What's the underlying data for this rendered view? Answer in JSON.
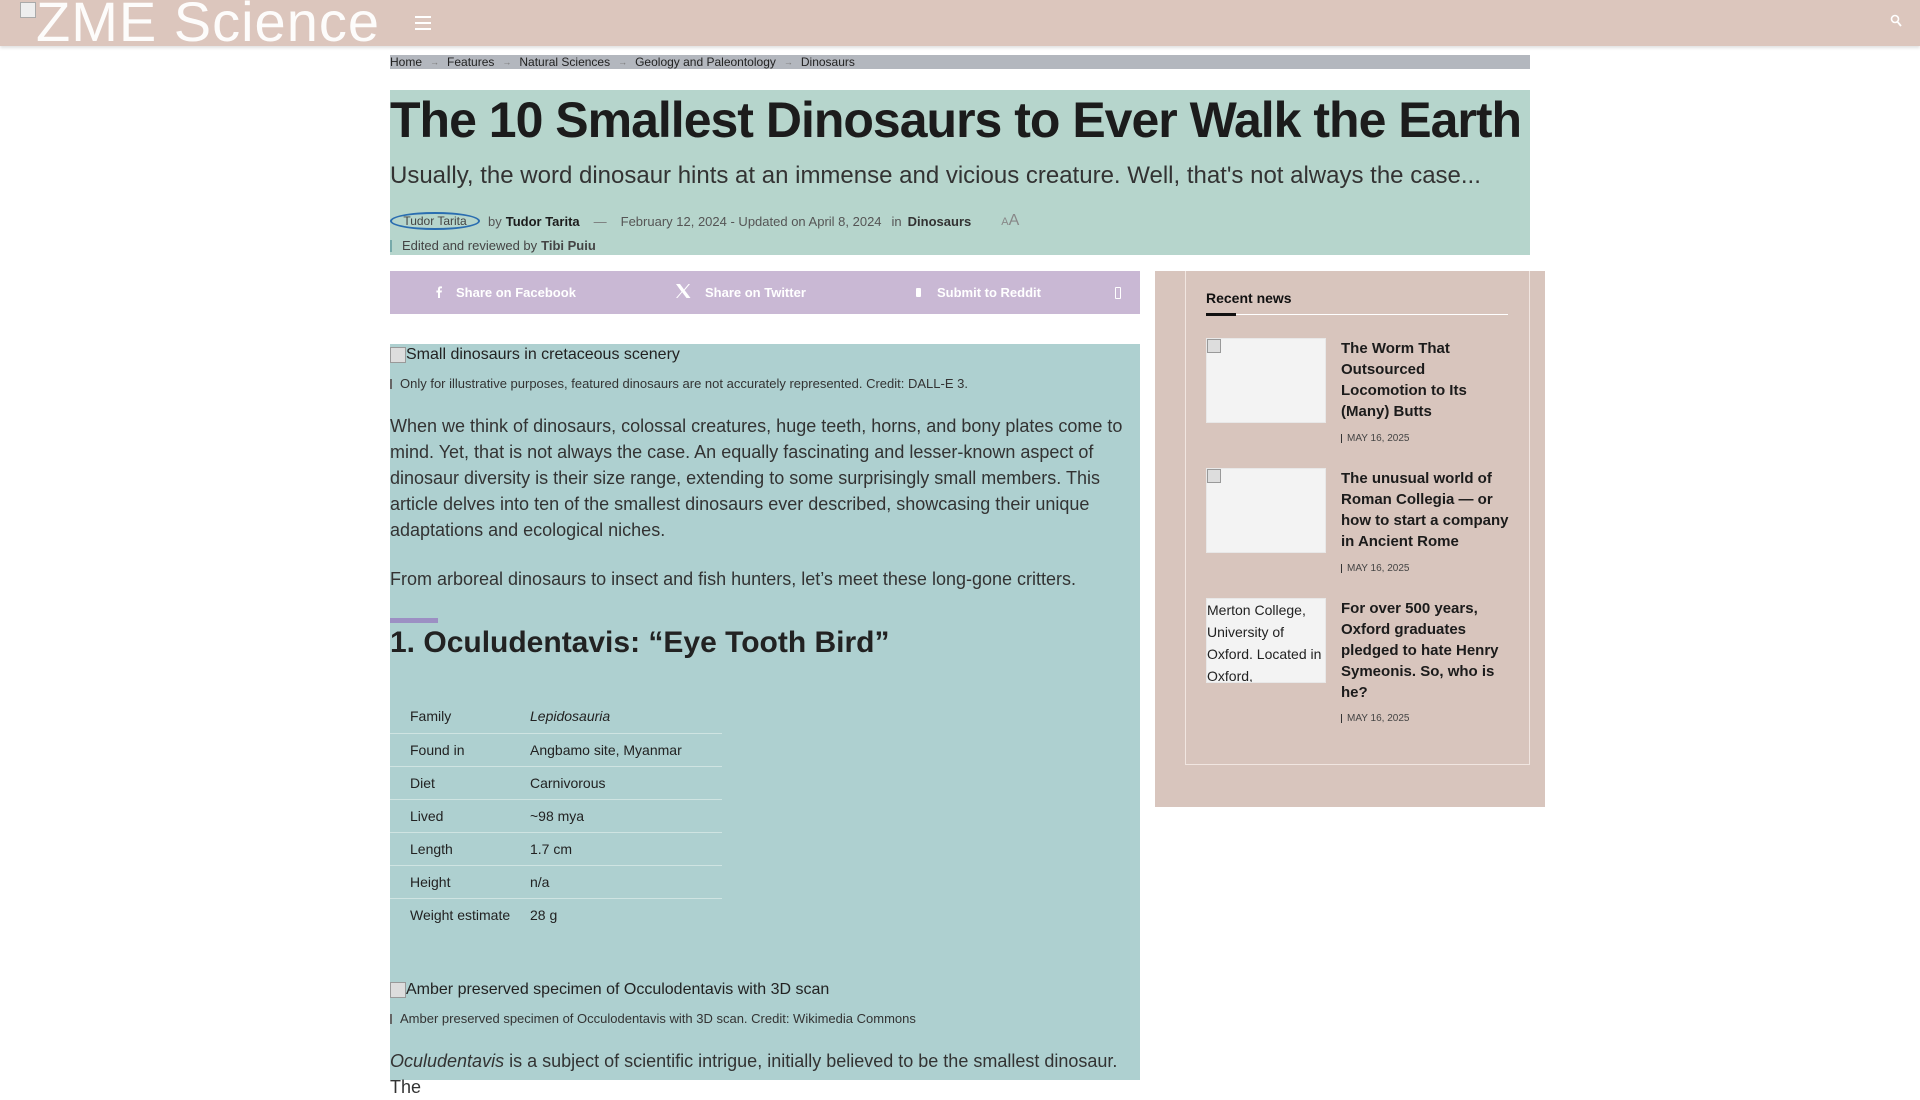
{
  "header": {
    "logo_text": "ZME Science",
    "menu_icon": "hamburger-icon",
    "search_icon": "search-icon",
    "background": "#dcc6bd"
  },
  "breadcrumb": [
    "Home",
    "Features",
    "Natural Sciences",
    "Geology and Paleontology",
    "Dinosaurs"
  ],
  "article": {
    "title": "The 10 Smallest Dinosaurs to Ever Walk the Earth",
    "subtitle": "Usually, the word dinosaur hints at an immense and vicious creature. Well, that's not always the case...",
    "avatar_alt": "Tudor Tarita",
    "by": "by",
    "author": "Tudor Tarita",
    "dash": "—",
    "date": "February 12, 2024 - Updated on April 8, 2024",
    "in": "in",
    "category": "Dinosaurs",
    "font_small": "A",
    "font_large": "A",
    "edited_prefix": "Edited and reviewed by",
    "editor": "Tibi Puiu",
    "share": {
      "facebook": "Share on Facebook",
      "twitter": "Share on Twitter",
      "reddit": "Submit to Reddit"
    },
    "hero_alt": "Small dinosaurs in cretaceous scenery",
    "hero_caption": "Only for illustrative purposes, featured dinosaurs are not accurately represented. Credit: DALL-E 3.",
    "para1": "When we think of dinosaurs, colossal creatures, huge teeth, horns, and bony plates come to mind. Yet, that is not always the case. An equally fascinating and lesser-known aspect of dinosaur diversity is their size range, extending to some surprisingly small members. This article delves into ten of the smallest dinosaurs ever described, showcasing their unique adaptations and ecological niches.",
    "para2": "From arboreal dinosaurs to insect and fish hunters, let’s meet these long-gone critters.",
    "section_title": "1. Oculudentavis: “Eye Tooth Bird”",
    "facts": [
      {
        "k": "Family",
        "v": "Lepidosauria"
      },
      {
        "k": "Found in",
        "v": "Angbamo site, Myanmar"
      },
      {
        "k": "Diet",
        "v": "Carnivorous"
      },
      {
        "k": "Lived",
        "v": "~98 mya"
      },
      {
        "k": "Length",
        "v": "1.7 cm"
      },
      {
        "k": "Height",
        "v": "n/a"
      },
      {
        "k": "Weight estimate",
        "v": "28 g"
      }
    ],
    "img2_alt": "Amber preserved specimen of Occulodentavis with 3D scan",
    "img2_caption": "Amber preserved specimen of Occulodentavis with 3D scan. Credit: Wikimedia Commons",
    "para3_italic": "Oculudentavis",
    "para3_rest": " is a subject of scientific intrigue, initially believed to be the smallest dinosaur. The"
  },
  "sidebar": {
    "title": "Recent news",
    "items": [
      {
        "title": "The Worm That Outsourced Locomotion to Its (Many) Butts",
        "date": "MAY 16, 2025",
        "thumb_alt": ""
      },
      {
        "title": "The unusual world of Roman Collegia — or how to start a company in Ancient Rome",
        "date": "MAY 16, 2025",
        "thumb_alt": ""
      },
      {
        "title": "For over 500 years, Oxford graduates pledged to hate Henry Symeonis. So, who is he?",
        "date": "MAY 16, 2025",
        "thumb_alt": "Merton College, University of Oxford. Located in Oxford,"
      }
    ]
  },
  "colors": {
    "title_band": "#b6d5cc",
    "share_bar": "#c9b8d4",
    "article_bg": "#aed0d0",
    "sidebar_bg": "#d8c5bd",
    "section_accent": "#9c8fc3"
  }
}
